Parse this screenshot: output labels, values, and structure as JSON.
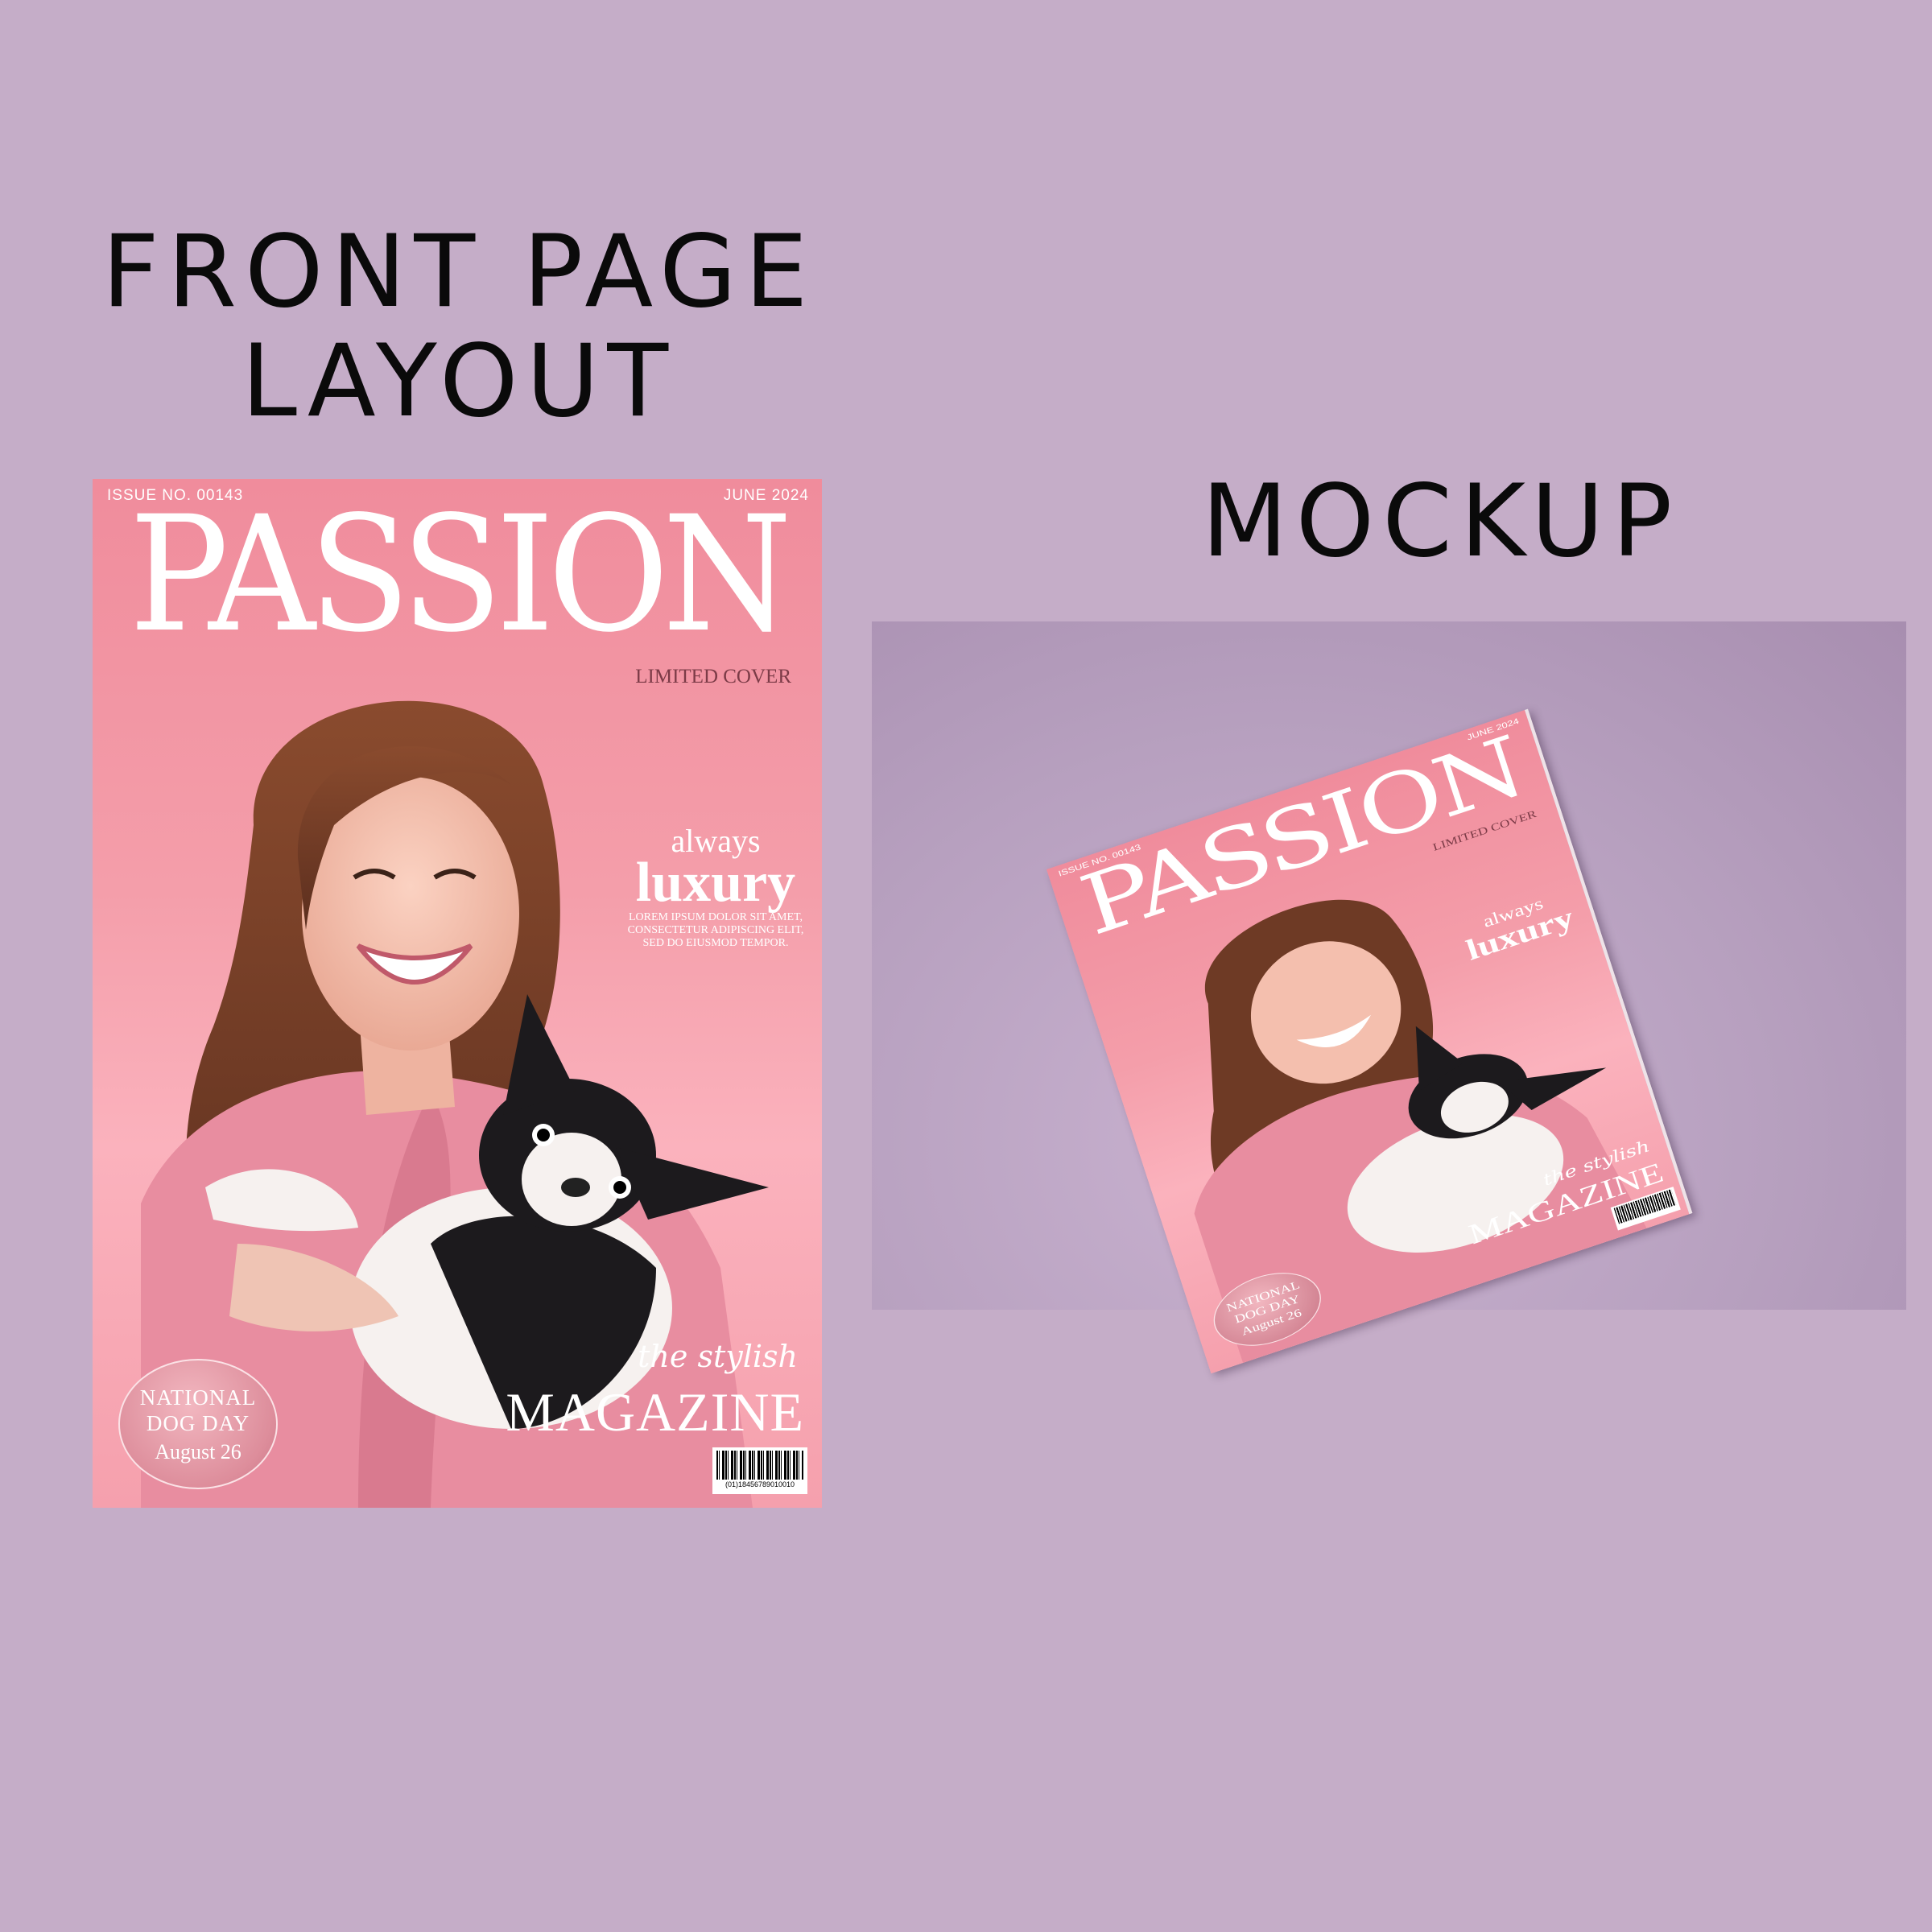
{
  "headings": {
    "layout_line1": "FRONT PAGE",
    "layout_line2": "LAYOUT",
    "mockup": "MOCKUP"
  },
  "cover": {
    "issue": "ISSUE NO. 00143",
    "date": "JUNE 2024",
    "title": "PASSION",
    "subtitle": "LIMITED COVER",
    "feature_small": "always",
    "feature_big": "luxury",
    "feature_body": "LOREM IPSUM DOLOR SIT AMET, CONSECTETUR ADIPISCING ELIT, SED DO EIUSMOD TEMPOR.",
    "tagline_script": "the stylish",
    "tagline_main": "MAGAZINE",
    "badge_line1": "NATIONAL",
    "badge_line2": "DOG DAY",
    "badge_line3": "August 26",
    "barcode_number": "(01)18456789010010"
  },
  "colors": {
    "background": "#c5adc8",
    "cover_pink": "#f49eaa",
    "subtitle": "#7c3b47",
    "heading_text": "#0a0a0a"
  }
}
